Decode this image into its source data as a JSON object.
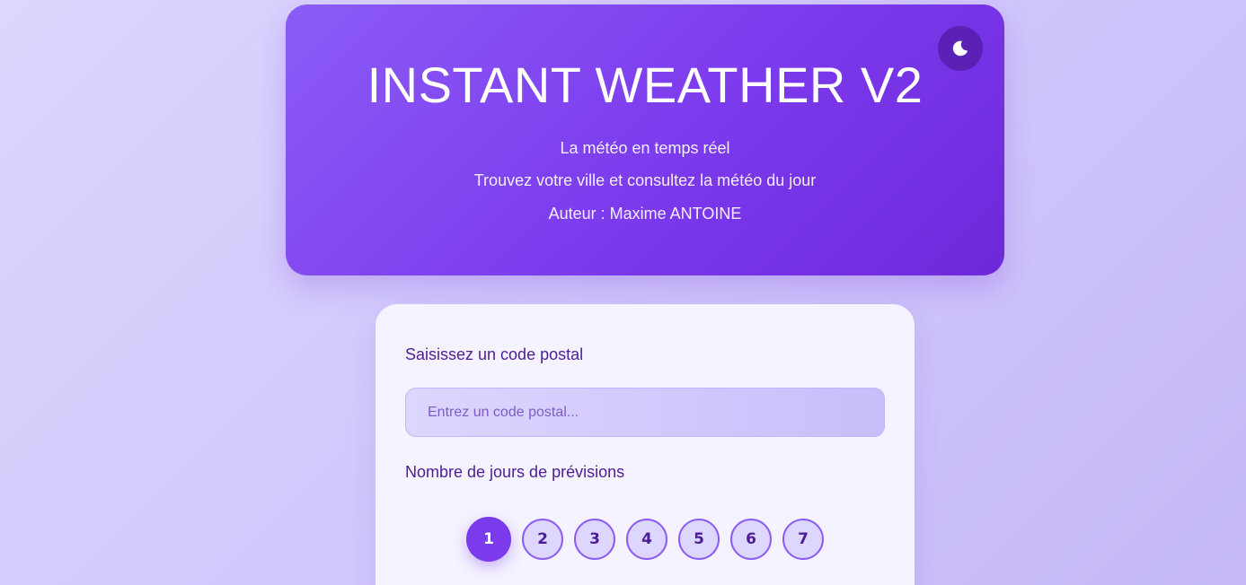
{
  "header": {
    "title": "INSTANT WEATHER V2",
    "tagline": "La météo en temps réel",
    "description": "Trouvez votre ville et consultez la météo du jour",
    "author": "Auteur : Maxime ANTOINE",
    "theme_toggle_icon": "moon-icon"
  },
  "form": {
    "postal_label": "Saisissez un code postal",
    "postal_placeholder": "Entrez un code postal...",
    "postal_value": "",
    "days_label": "Nombre de jours de prévisions",
    "days_options": [
      "1",
      "2",
      "3",
      "4",
      "5",
      "6",
      "7"
    ],
    "days_selected": "1"
  },
  "colors": {
    "accent": "#7c3aed",
    "header_gradient_start": "#8b5cf6",
    "header_gradient_end": "#6d28d9",
    "text_dark": "#4c1d95",
    "card_bg": "#f5f3ff",
    "page_bg": "#ddd6fe"
  }
}
